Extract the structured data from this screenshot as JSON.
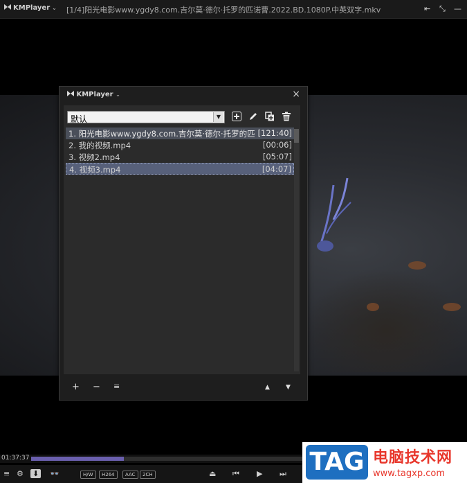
{
  "titlebar": {
    "brand": "KMPlayer",
    "title": "[1/4]阳光电影www.ygdy8.com.吉尔莫·德尔·托罗的匹诺曹.2022.BD.1080P.中英双字.mkv",
    "pin_icon": "pin-icon",
    "minimize_icon": "minimize-icon"
  },
  "playlist": {
    "brand": "KMPlayer",
    "select_value": "默认",
    "items": [
      {
        "name": "1. 阳光电影www.ygdy8.com.吉尔莫·德尔·托罗的匹",
        "duration": "[121:40]"
      },
      {
        "name": "2. 我的视频.mp4",
        "duration": "[00:06]"
      },
      {
        "name": "3. 视频2.mp4",
        "duration": "[05:07]"
      },
      {
        "name": "4. 视频3.mp4",
        "duration": "[04:07]"
      }
    ],
    "footer": {
      "add": "+",
      "remove": "−",
      "menu": "≡",
      "up": "▲",
      "down": "▼"
    }
  },
  "controls": {
    "time": "01:37:37",
    "progress": 0.32,
    "codecs": [
      "H/W",
      "H264",
      "AAC",
      "2CH"
    ]
  },
  "watermark": {
    "tag": "TAG",
    "cn": "电脑技术网",
    "url": "www.tagxp.com"
  },
  "colors": {
    "accent": "#6a5fae",
    "selected_row": "#57607a",
    "watermark_blue": "#1e6fc0",
    "watermark_red": "#e8372c"
  }
}
